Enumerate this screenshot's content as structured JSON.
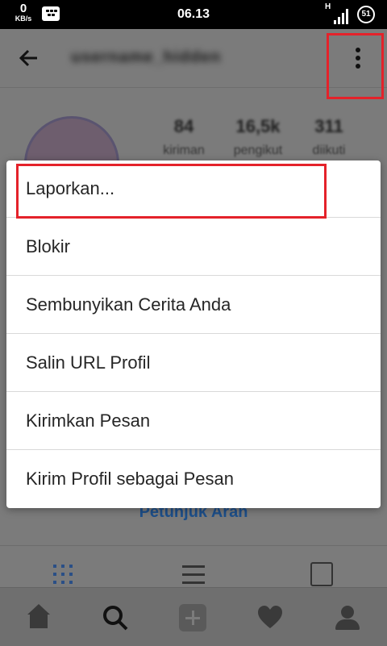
{
  "status_bar": {
    "net_speed": "0",
    "net_speed_unit": "KB/s",
    "time": "06.13",
    "network_type": "H",
    "battery": "51"
  },
  "profile": {
    "username": "username_hidden",
    "stats": [
      {
        "value": "84",
        "label": "kiriman"
      },
      {
        "value": "16,5k",
        "label": "pengikut"
      },
      {
        "value": "311",
        "label": "diikuti"
      }
    ],
    "directions_label": "Petunjuk Arah"
  },
  "menu": {
    "items": [
      "Laporkan...",
      "Blokir",
      "Sembunyikan Cerita Anda",
      "Salin URL Profil",
      "Kirimkan Pesan",
      "Kirim Profil sebagai Pesan"
    ],
    "highlighted_item": "Laporkan..."
  },
  "icons": {
    "back": "arrow-left-icon",
    "more": "more-vertical-icon",
    "grid": "grid-icon",
    "list": "list-icon",
    "tagged": "tagged-icon",
    "home": "home-icon",
    "search": "search-icon",
    "add": "add-icon",
    "activity": "heart-icon",
    "profile": "profile-icon"
  },
  "colors": {
    "highlight": "#e4222a",
    "link": "#1d4f8a",
    "overlay": "#7b7b7b"
  }
}
